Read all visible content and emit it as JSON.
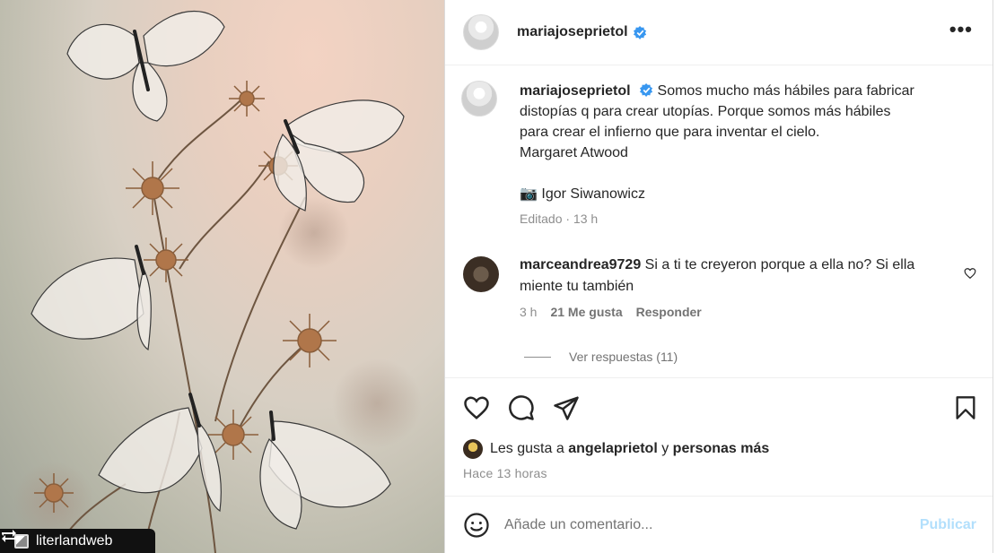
{
  "post": {
    "username": "mariajoseprietol",
    "verified": true,
    "more_label": "•••"
  },
  "media": {
    "watermark_text": "literlandweb"
  },
  "caption": {
    "username": "mariajoseprietol",
    "line1": "Somos mucho más hábiles para fabricar",
    "line2": "distopías q para crear utopías. Porque somos más hábiles",
    "line3": "para crear el infierno que para inventar el cielo.",
    "line4": "Margaret Atwood",
    "credit": "📷 Igor Siwanowicz",
    "meta": "Editado · 13 h"
  },
  "comment": {
    "username": "marceandrea9729",
    "text": "Si a ti te creyeron porque a ella no? Si ella miente tu también",
    "time": "3 h",
    "likes": "21 Me gusta",
    "reply": "Responder",
    "view_replies": "Ver respuestas (11)"
  },
  "likes": {
    "prefix": "Les gusta a",
    "user": "angelaprietol",
    "middle": "y",
    "suffix": "personas más",
    "time": "Hace 13 horas"
  },
  "add_comment": {
    "placeholder": "Añade un comentario...",
    "publish": "Publicar"
  },
  "icons": [
    "heart-icon",
    "comment-icon",
    "share-icon",
    "bookmark-icon",
    "emoji-icon",
    "verified-icon",
    "more-icon",
    "repost-icon"
  ],
  "colors": {
    "verified": "#3897f0",
    "publish_disabled": "#b2dffc",
    "muted": "#8e8e8e"
  }
}
